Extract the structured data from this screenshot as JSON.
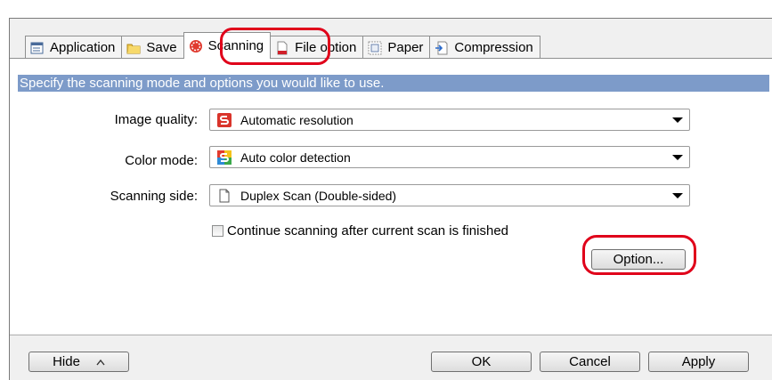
{
  "tabs": [
    {
      "label": "Application",
      "icon": "application-icon"
    },
    {
      "label": "Save",
      "icon": "folder-icon"
    },
    {
      "label": "Scanning",
      "icon": "scanning-icon",
      "active": true
    },
    {
      "label": "File option",
      "icon": "file-option-icon"
    },
    {
      "label": "Paper",
      "icon": "paper-icon"
    },
    {
      "label": "Compression",
      "icon": "compression-icon"
    }
  ],
  "banner": "Specify the scanning mode and options you would like to use.",
  "fields": {
    "image_quality": {
      "label": "Image quality:",
      "value": "Automatic resolution",
      "icon": "automatic-resolution-icon"
    },
    "color_mode": {
      "label": "Color mode:",
      "value": "Auto color detection",
      "icon": "auto-color-icon"
    },
    "scanning_side": {
      "label": "Scanning side:",
      "value": "Duplex Scan (Double-sided)",
      "icon": "duplex-page-icon"
    }
  },
  "continue_scanning": {
    "label": "Continue scanning after current scan is finished",
    "checked": false
  },
  "option_button": "Option...",
  "footer": {
    "hide": "Hide",
    "ok": "OK",
    "cancel": "Cancel",
    "apply": "Apply"
  },
  "colors": {
    "highlight": "#e0001a",
    "banner": "#7d9bc9"
  }
}
